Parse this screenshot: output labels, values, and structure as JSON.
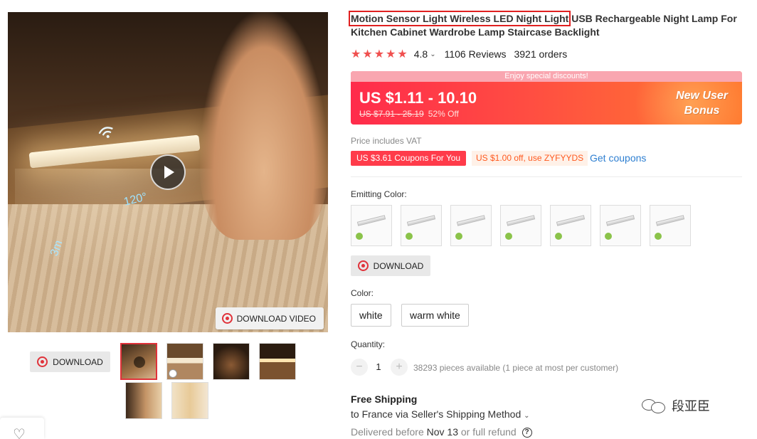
{
  "gallery": {
    "main_image_alt": "",
    "overlay": {
      "angle": "120°",
      "distance": "3m"
    },
    "download_video_label": "DOWNLOAD VIDEO",
    "download_label": "DOWNLOAD"
  },
  "product": {
    "title_highlighted": "Motion Sensor Light Wireless LED Night Light",
    "title_rest": " USB Rechargeable Night Lamp For Kitchen Cabinet Wardrobe Lamp Staircase Backlight",
    "rating": "4.8",
    "reviews": "1106 Reviews",
    "orders": "3921 orders"
  },
  "price": {
    "banner_strip": "Enjoy special discounts!",
    "current": "US $1.11 - 10.10",
    "original": "US $7.91 - 25.19",
    "discount": "52% Off",
    "new_user_line1": "New User",
    "new_user_line2": "Bonus",
    "vat_note": "Price includes VAT",
    "coupon_red": "US $3.61 Coupons For You",
    "coupon_orange": "US $1.00 off, use ZYFYYDS",
    "get_coupons": "Get coupons"
  },
  "emitting_color": {
    "label": "Emitting Color:",
    "swatch_count_visible": 7,
    "download_label": "DOWNLOAD"
  },
  "color": {
    "label": "Color:",
    "options": [
      "white",
      "warm white"
    ]
  },
  "quantity": {
    "label": "Quantity:",
    "minus": "−",
    "value": "1",
    "plus": "+",
    "availability": "38293 pieces available (1 piece at most per customer)"
  },
  "shipping": {
    "title": "Free Shipping",
    "destination": "to France via Seller's Shipping Method",
    "delivery_prefix": "Delivered before ",
    "delivery_date": "Nov 13",
    "delivery_suffix": " or full refund"
  },
  "watermark": {
    "text": "段亚臣"
  },
  "colors": {
    "accent_red": "#ff3b4a",
    "star_red": "#f0504f",
    "link_blue": "#2e7fd1",
    "coupon_orange": "#ff5a1f",
    "highlight_outline": "#e02020"
  }
}
